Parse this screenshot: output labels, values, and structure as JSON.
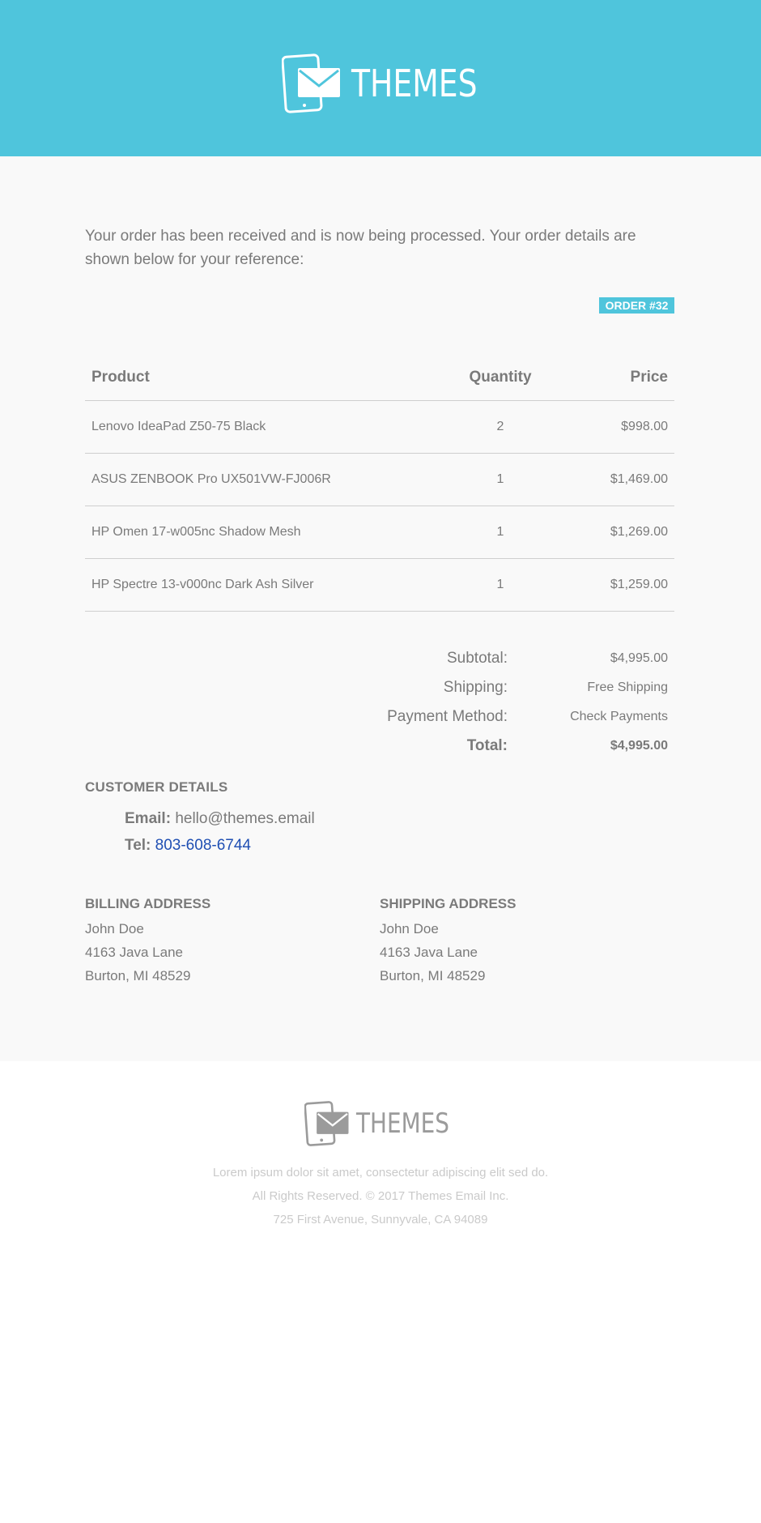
{
  "brand": {
    "name": "THEMES",
    "header_bg": "#4fc5dc",
    "icon": "tablet-envelope-icon"
  },
  "intro": "Your order has been received and is now being processed. Your order details are shown below for your reference:",
  "order_badge": "ORDER #32",
  "table": {
    "headers": {
      "product": "Product",
      "quantity": "Quantity",
      "price": "Price"
    },
    "rows": [
      {
        "product": "Lenovo IdeaPad Z50-75 Black",
        "quantity": "2",
        "price": "$998.00"
      },
      {
        "product": "ASUS ZENBOOK Pro UX501VW-FJ006R",
        "quantity": "1",
        "price": "$1,469.00"
      },
      {
        "product": "HP Omen 17-w005nc Shadow Mesh",
        "quantity": "1",
        "price": "$1,269.00"
      },
      {
        "product": "HP Spectre 13-v000nc Dark Ash Silver",
        "quantity": "1",
        "price": "$1,259.00"
      }
    ]
  },
  "totals": {
    "subtotal_label": "Subtotal:",
    "subtotal": "$4,995.00",
    "shipping_label": "Shipping:",
    "shipping": "Free Shipping",
    "payment_label": "Payment Method:",
    "payment": "Check Payments",
    "total_label": "Total:",
    "total": "$4,995.00"
  },
  "customer": {
    "title": "CUSTOMER DETAILS",
    "email_label": "Email:",
    "email": "hello@themes.email",
    "tel_label": "Tel:",
    "tel": "803-608-6744"
  },
  "billing": {
    "title": "BILLING ADDRESS",
    "name": "John Doe",
    "street": "4163 Java Lane",
    "city": "Burton, MI 48529"
  },
  "shipping_address": {
    "title": "SHIPPING ADDRESS",
    "name": "John Doe",
    "street": "4163 Java Lane",
    "city": "Burton, MI 48529"
  },
  "footer": {
    "line1": "Lorem ipsum dolor sit amet, consectetur adipiscing elit sed do.",
    "line2": "All Rights Reserved. © 2017 Themes Email Inc.",
    "line3": "725 First Avenue, Sunnyvale, CA 94089"
  }
}
